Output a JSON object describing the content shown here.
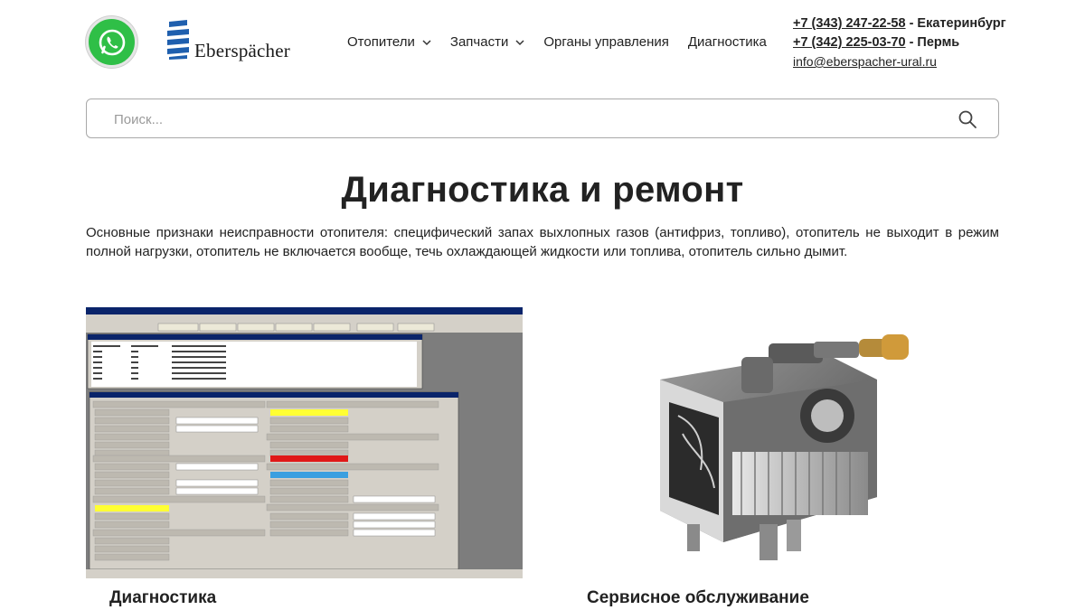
{
  "brand": {
    "name": "Eberspächer",
    "accent": "#1f5fae",
    "whatsapp_color": "#2fbf47"
  },
  "nav": {
    "items": [
      {
        "label": "Отопители",
        "has_dropdown": true
      },
      {
        "label": "Запчасти",
        "has_dropdown": true
      },
      {
        "label": "Органы управления",
        "has_dropdown": false
      },
      {
        "label": "Диагностика",
        "has_dropdown": false
      }
    ]
  },
  "contacts": {
    "phone1": "+7 (343) 247-22-58",
    "city1": " - Екатеринбург",
    "phone2": "+7 (342) 225-03-70",
    "city2": " - Пермь",
    "email": "info@eberspacher-ural.ru"
  },
  "search": {
    "placeholder": "Поиск..."
  },
  "page": {
    "title": "Диагностика и ремонт",
    "intro": "Основные признаки неисправности отопителя: специфический запах выхлопных газов (антифриз, топливо), отопитель не выходит в режим полной нагрузки, отопитель не включается вообще, течь охлаждающей жидкости или топлива, отопитель сильно дымит."
  },
  "cards": [
    {
      "title": "Диагностика",
      "image": "diagnostic-software-screenshot"
    },
    {
      "title": "Сервисное обслуживание",
      "image": "heater-cutaway"
    }
  ]
}
